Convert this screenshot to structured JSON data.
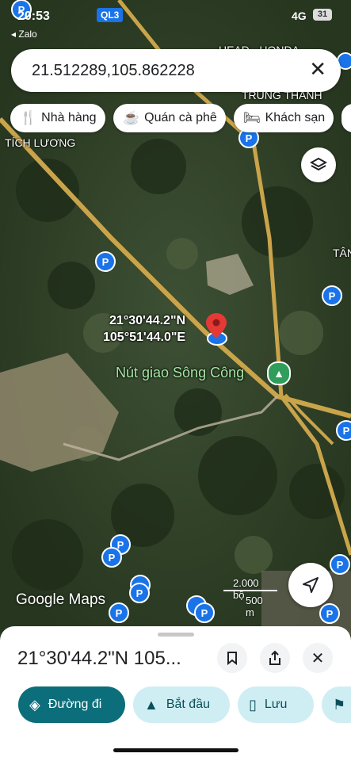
{
  "status_bar": {
    "time": "20:53",
    "back_app": "◂ Zalo",
    "road_badge": "QL3",
    "network": "4G",
    "battery": "31"
  },
  "search": {
    "query": "21.512289,105.862228"
  },
  "chips": [
    {
      "label": "Nhà hàng",
      "icon": "fork-knife-icon"
    },
    {
      "label": "Quán cà phê",
      "icon": "coffee-icon"
    },
    {
      "label": "Khách sạn",
      "icon": "bed-icon"
    }
  ],
  "map_labels": {
    "tich_luong": "TÍCH LƯƠNG",
    "trung_thanh": "TRUNG THÀNH",
    "head_honda": "HEAD - HONDA",
    "tan": "TÂN",
    "poi_name": "Nút giao Sông Công"
  },
  "pin": {
    "lat_label": "21°30'44.2\"N",
    "lng_label": "105°51'44.0\"E"
  },
  "map_footer": {
    "logo": "Google Maps",
    "scale_ft": "2.000 bộ",
    "scale_m": "500 m"
  },
  "sheet": {
    "title": "21°30'44.2\"N 105...",
    "actions": [
      {
        "label": "Đường đi",
        "icon": "directions-icon"
      },
      {
        "label": "Bắt đầu",
        "icon": "navigation-arrow-icon"
      },
      {
        "label": "Lưu",
        "icon": "bookmark-icon"
      }
    ]
  }
}
